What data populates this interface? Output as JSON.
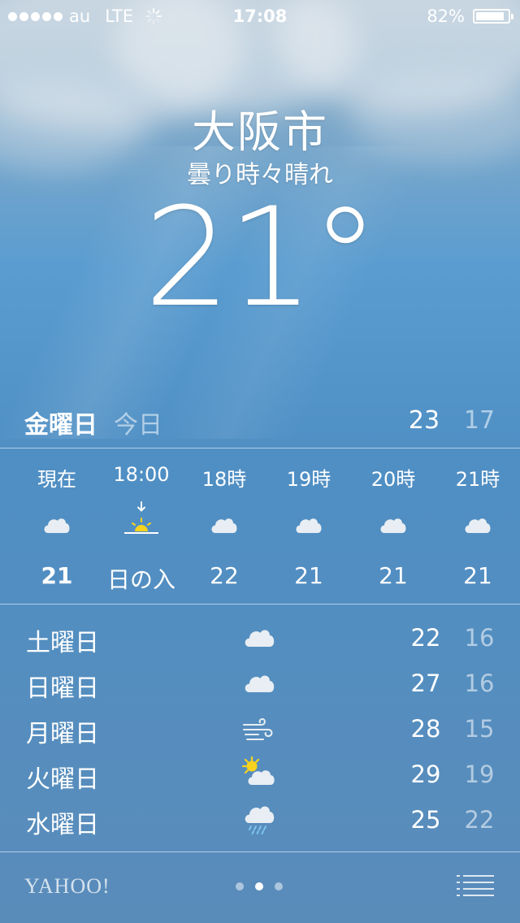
{
  "status_bar": {
    "carrier": "au",
    "network": "LTE",
    "time": "17:08",
    "battery": "82%",
    "battery_level": 0.82
  },
  "location": {
    "city": "大阪市",
    "condition": "曇り時々晴れ",
    "temperature": "21°"
  },
  "today": {
    "day": "金曜日",
    "label": "今日",
    "high": "23",
    "low": "17"
  },
  "hourly": [
    {
      "label": "現在",
      "icon": "cloud-icon",
      "value": "21",
      "bold": true
    },
    {
      "label": "18:00",
      "icon": "sunset-icon",
      "value": "日の入",
      "bold": false
    },
    {
      "label": "18時",
      "icon": "cloud-icon",
      "value": "22",
      "bold": false
    },
    {
      "label": "19時",
      "icon": "cloud-icon",
      "value": "21",
      "bold": false
    },
    {
      "label": "20時",
      "icon": "cloud-icon",
      "value": "21",
      "bold": false
    },
    {
      "label": "21時",
      "icon": "cloud-icon",
      "value": "21",
      "bold": false
    }
  ],
  "daily": [
    {
      "day": "土曜日",
      "icon": "cloud-icon",
      "high": "22",
      "low": "16"
    },
    {
      "day": "日曜日",
      "icon": "cloud-icon",
      "high": "27",
      "low": "16"
    },
    {
      "day": "月曜日",
      "icon": "wind-icon",
      "high": "28",
      "low": "15"
    },
    {
      "day": "火曜日",
      "icon": "partly-sunny-icon",
      "high": "29",
      "low": "19"
    },
    {
      "day": "水曜日",
      "icon": "rain-icon",
      "high": "25",
      "low": "22"
    }
  ],
  "footer": {
    "brand": "YAHOO!",
    "pages": 3,
    "active_page": 2
  },
  "colors": {
    "sun": "#f7d21e",
    "cloud": "#e8eef3"
  }
}
